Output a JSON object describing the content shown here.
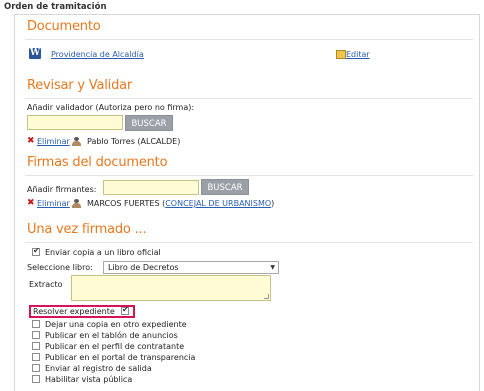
{
  "page_title": "Orden de tramitación",
  "documento": {
    "heading": "Documento",
    "word_icon_letter": "W",
    "doc_link": "Providencia de Alcaldía",
    "edit_link": "Editar"
  },
  "revisar": {
    "heading": "Revisar y Validar",
    "add_label": "Añadir validador (Autoriza pero no firma):",
    "input_value": "",
    "search_button": "BUSCAR",
    "delete_link": "Eliminar",
    "user_name": "Pablo Torres (ALCALDE)"
  },
  "firmas": {
    "heading": "Firmas del documento",
    "add_label": "Añadir firmantes:",
    "input_value": "",
    "search_button": "BUSCAR",
    "delete_link": "Eliminar",
    "user_name": "MARCOS FUERTES (",
    "user_role_link": "CONCEJAL DE URBANISMO",
    "user_close": ")"
  },
  "una_vez": {
    "heading": "Una vez firmado ...",
    "copy_label": "Enviar copia a un libro oficial",
    "copy_checked": true,
    "book_label": "Seleccione libro:",
    "book_selected": "Libro de Decretos",
    "extract_label": "Extracto",
    "resolve_label": "Resolver expediente",
    "resolve_checked": true,
    "options": [
      {
        "label": "Dejar una copia en otro expediente",
        "checked": false
      },
      {
        "label": "Publicar en el tablón de anuncios",
        "checked": false
      },
      {
        "label": "Publicar en el perfil de contratante",
        "checked": false
      },
      {
        "label": "Publicar en el portal de transparencia",
        "checked": false
      },
      {
        "label": "Enviar al registro de salida",
        "checked": false
      },
      {
        "label": "Habilitar vista pública",
        "checked": false
      }
    ]
  },
  "colors": {
    "accent": "#e8781e",
    "link": "#2a5db0",
    "highlight": "#d6135a",
    "input_bg": "#fffbd5"
  }
}
